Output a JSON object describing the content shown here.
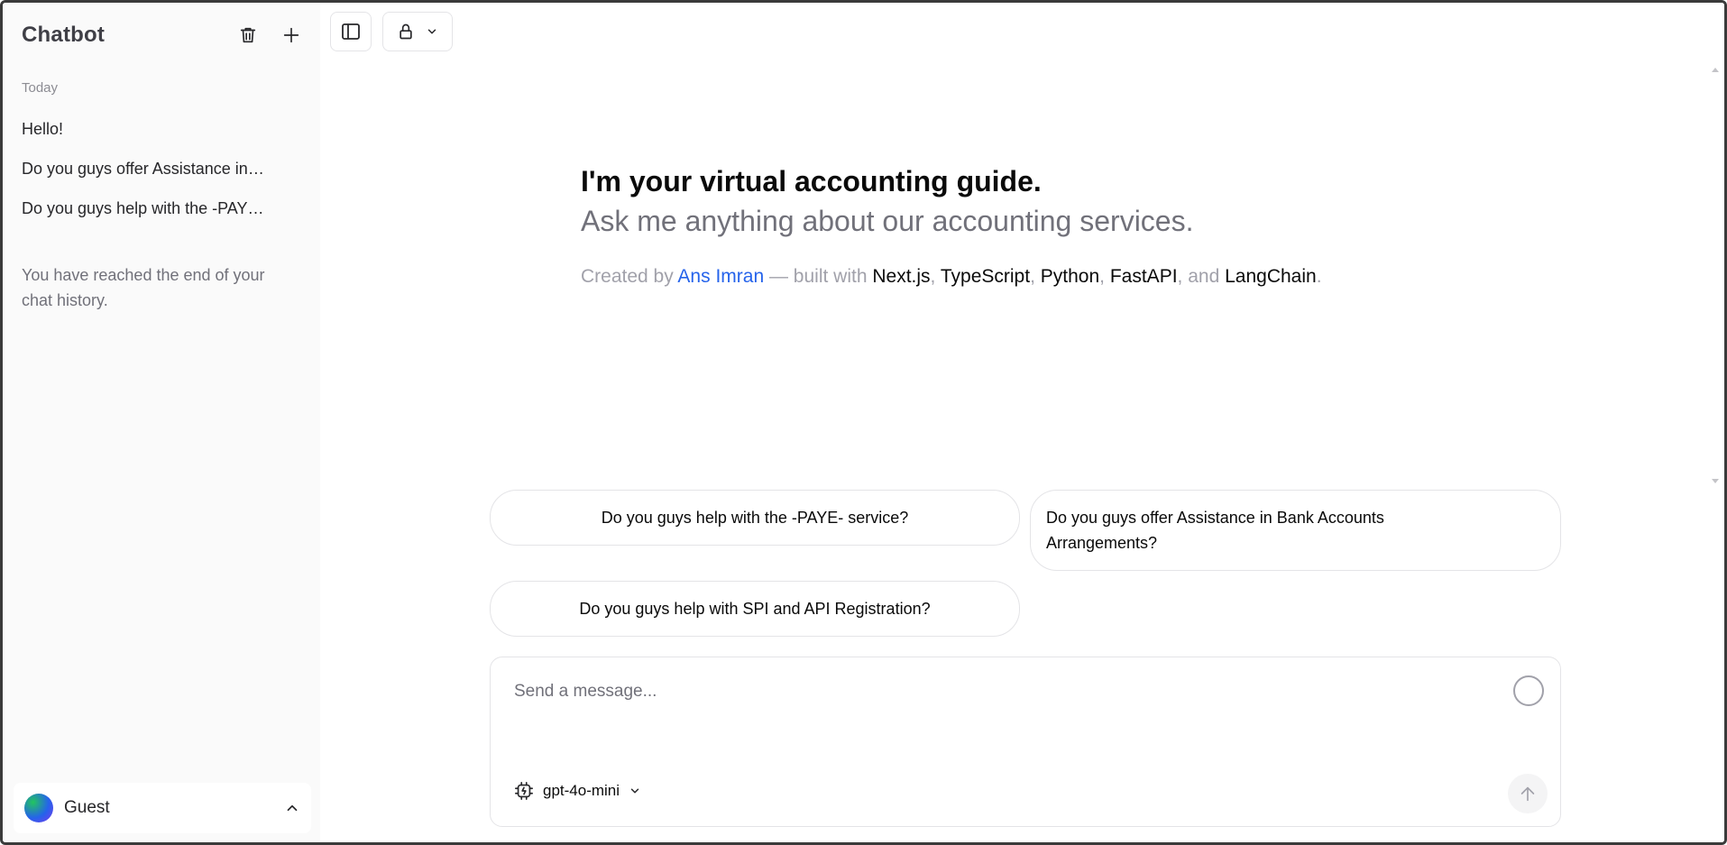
{
  "sidebar": {
    "title": "Chatbot",
    "section_label": "Today",
    "items": [
      {
        "label": "Hello!"
      },
      {
        "label": "Do you guys offer Assistance in Bank Accounts Arrangements?"
      },
      {
        "label": "Do you guys help with the -PAYE- service?"
      }
    ],
    "end_message": "You have reached the end of your chat history.",
    "user": {
      "name": "Guest"
    }
  },
  "greeting": {
    "title": "I'm your virtual accounting guide.",
    "subtitle": "Ask me anything about our accounting services.",
    "credits": {
      "prefix": "Created by",
      "author": "Ans Imran",
      "middle": "— built with",
      "tech": [
        "Next.js",
        "TypeScript",
        "Python",
        "FastAPI",
        "LangChain"
      ],
      "sep": ",",
      "and": "and",
      "end": "."
    }
  },
  "suggestions": [
    {
      "label": "Do you guys help with the -PAYE- service?"
    },
    {
      "label": "Do you guys offer Assistance in Bank Accounts Arrangements?"
    },
    {
      "label": "Do you guys help with SPI and API Registration?"
    }
  ],
  "composer": {
    "placeholder": "Send a message...",
    "model": "gpt-4o-mini"
  },
  "icons": {
    "delete": "trash-icon",
    "new_chat": "plus-icon",
    "toggle_sidebar": "sidebar-toggle-icon",
    "visibility": "lock-icon",
    "model": "cpu-chip-icon",
    "send": "arrow-up-icon",
    "user_menu": "chevron-up-icon"
  },
  "colors": {
    "link": "#2563eb",
    "sidebar_bg": "#fafafa",
    "border": "#e4e4e7"
  }
}
